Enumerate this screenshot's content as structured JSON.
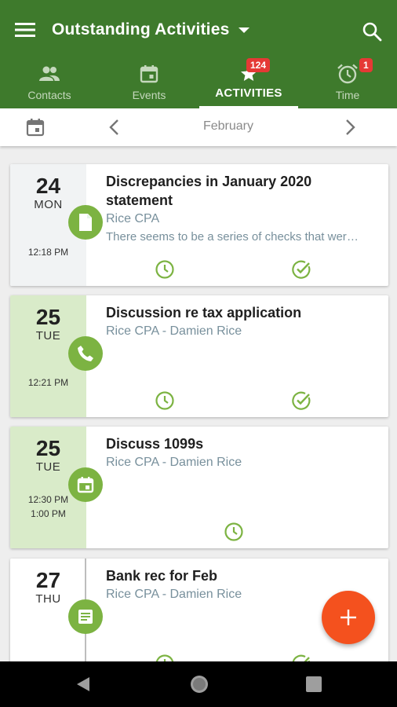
{
  "app": {
    "title": "Outstanding Activities"
  },
  "icons": {
    "menu": "hamburger-icon",
    "dropdown": "caret-down-icon",
    "search": "search-icon",
    "contacts": "people-icon",
    "events": "calendar-icon",
    "activities": "star-icon",
    "time": "alarm-clock-icon",
    "date_picker": "calendar-icon",
    "prev": "chevron-left-icon",
    "next": "chevron-right-icon",
    "add": "plus-icon"
  },
  "tabs": [
    {
      "label": "Contacts",
      "badge": ""
    },
    {
      "label": "Events",
      "badge": ""
    },
    {
      "label": "ACTIVITIES",
      "badge": "124"
    },
    {
      "label": "Time",
      "badge": "1"
    }
  ],
  "datebar": {
    "month": "February"
  },
  "activities": [
    {
      "day": "24",
      "weekday": "MON",
      "time": "12:18 PM",
      "end_time": "",
      "type": "document",
      "title": "Discrepancies in January 2020 statement",
      "subtitle": "Rice CPA",
      "description": "There seems to be a series of checks that were not accounted for"
    },
    {
      "day": "25",
      "weekday": "TUE",
      "time": "12:21 PM",
      "end_time": "",
      "type": "phone",
      "title": "Discussion re tax application",
      "subtitle": "Rice CPA - Damien Rice",
      "description": ""
    },
    {
      "day": "25",
      "weekday": "TUE",
      "time": "12:30 PM",
      "end_time": "1:00 PM",
      "type": "meeting",
      "title": "Discuss 1099s",
      "subtitle": "Rice CPA - Damien Rice",
      "description": ""
    },
    {
      "day": "27",
      "weekday": "THU",
      "time": "",
      "end_time": "",
      "type": "note",
      "title": "Bank rec for Feb",
      "subtitle": "Rice CPA - Damien Rice",
      "description": ""
    }
  ],
  "colors": {
    "appbar": "#3e7a2c",
    "accent_green": "#7cb342",
    "highlight": "#d9ebc9",
    "fab": "#f4511e",
    "badge": "#e53935"
  }
}
